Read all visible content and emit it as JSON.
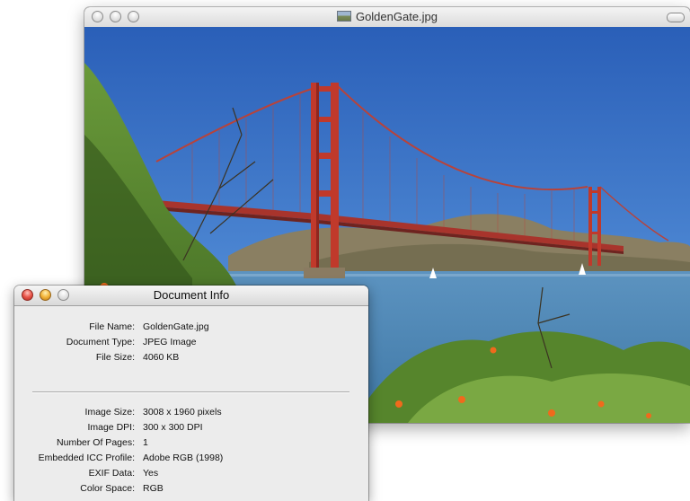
{
  "image_window": {
    "title": "GoldenGate.jpg",
    "icon": "image-document-icon",
    "photo_subject": "golden-gate-bridge-photo"
  },
  "info_window": {
    "title": "Document Info",
    "fields": [
      {
        "label": "File Name:",
        "value": "GoldenGate.jpg"
      },
      {
        "label": "Document Type:",
        "value": "JPEG Image"
      },
      {
        "label": "File Size:",
        "value": "4060 KB"
      },
      {
        "label": "Image Size:",
        "value": "3008 x 1960 pixels"
      },
      {
        "label": "Image DPI:",
        "value": "300 x 300 DPI"
      },
      {
        "label": "Number Of Pages:",
        "value": "1"
      },
      {
        "label": "Embedded ICC Profile:",
        "value": "Adobe RGB (1998)"
      },
      {
        "label": "EXIF Data:",
        "value": "Yes"
      },
      {
        "label": "Color Space:",
        "value": "RGB"
      }
    ]
  },
  "colors": {
    "bridge_red": "#c0392b",
    "sky_blue": "#3a73c9",
    "water_blue": "#4b87b5",
    "close_red": "#e9554a",
    "minimize_yellow": "#f3b53a",
    "zoom_green": "#77c44a"
  }
}
